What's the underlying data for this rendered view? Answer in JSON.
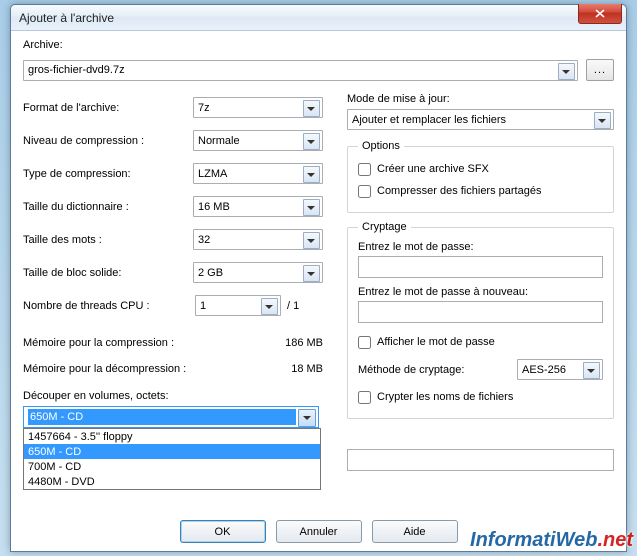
{
  "title": "Ajouter à l'archive",
  "archive": {
    "label": "Archive:",
    "value": "gros-fichier-dvd9.7z",
    "browse": "..."
  },
  "left": {
    "format": {
      "label": "Format de l'archive:",
      "value": "7z"
    },
    "level": {
      "label": "Niveau de compression :",
      "value": "Normale"
    },
    "method": {
      "label": "Type de compression:",
      "value": "LZMA"
    },
    "dict": {
      "label": "Taille du dictionnaire :",
      "value": "16 MB"
    },
    "word": {
      "label": "Taille des mots :",
      "value": "32"
    },
    "block": {
      "label": "Taille de bloc solide:",
      "value": "2 GB"
    },
    "threads": {
      "label": "Nombre de threads CPU :",
      "value": "1",
      "of": "/ 1"
    },
    "mem_comp": {
      "label": "Mémoire pour la compression :",
      "value": "186 MB"
    },
    "mem_decomp": {
      "label": "Mémoire pour la décompression :",
      "value": "18 MB"
    },
    "split": {
      "label": "Découper en volumes, octets:",
      "selected": "650M - CD",
      "options": [
        "1457664 - 3.5'' floppy",
        "650M - CD",
        "700M - CD",
        "4480M - DVD"
      ]
    }
  },
  "right": {
    "mode": {
      "label": "Mode de mise à jour:",
      "value": "Ajouter et remplacer les fichiers"
    },
    "options": {
      "legend": "Options",
      "sfx": "Créer une archive SFX",
      "shared": "Compresser des fichiers partagés"
    },
    "crypt": {
      "legend": "Cryptage",
      "pw1": "Entrez le mot de passe:",
      "pw2": "Entrez le mot de passe à nouveau:",
      "show": "Afficher le mot de passe",
      "method_lbl": "Méthode de cryptage:",
      "method_val": "AES-256",
      "names": "Crypter les noms de fichiers"
    }
  },
  "buttons": {
    "ok": "OK",
    "cancel": "Annuler",
    "help": "Aide"
  },
  "watermark": {
    "a": "Informati",
    "b": "Web",
    "c": ".net"
  }
}
